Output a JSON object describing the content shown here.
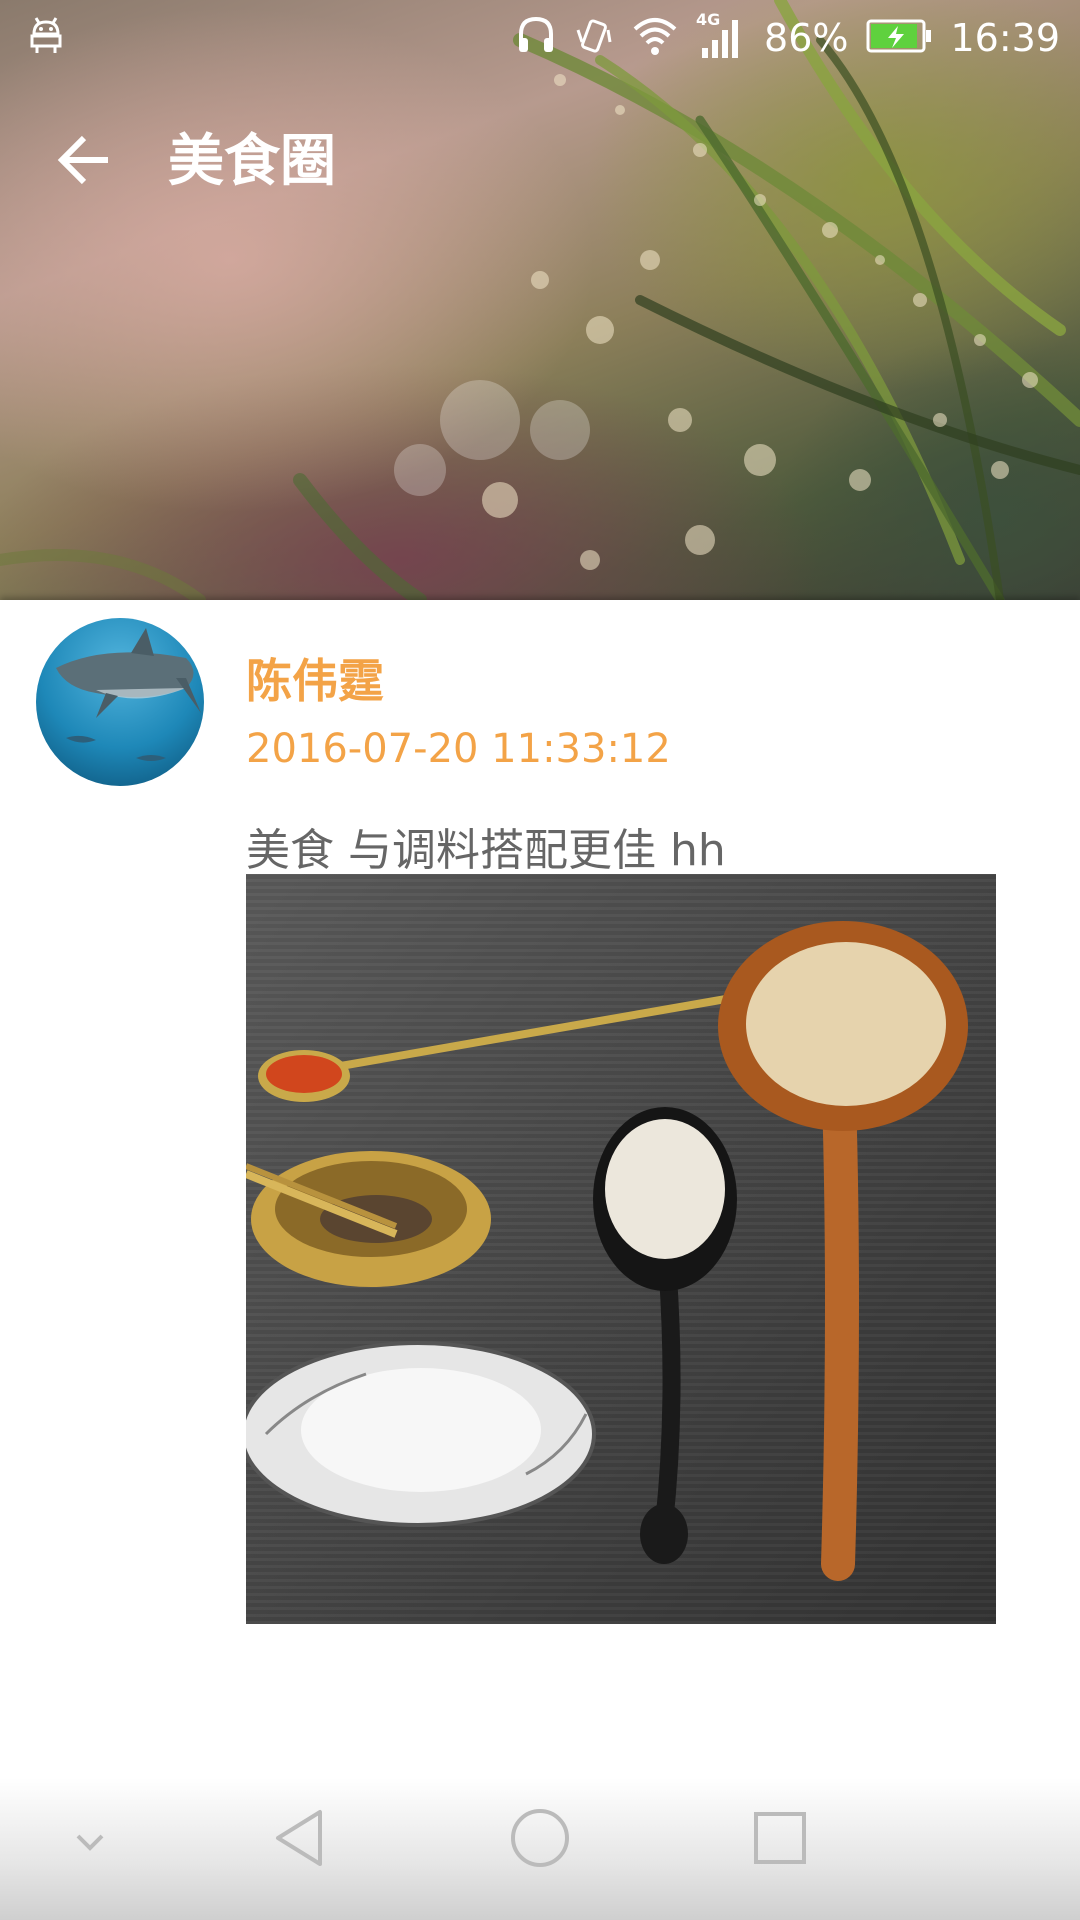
{
  "status_bar": {
    "battery_percent": "86%",
    "time": "16:39",
    "network_type": "4G",
    "icons": [
      "android-debug-icon",
      "headphone-icon",
      "vibrate-icon",
      "wifi-icon",
      "signal-icon",
      "battery-charging-icon"
    ]
  },
  "app_bar": {
    "title": "美食圈",
    "back_icon": "arrow-left-icon"
  },
  "post": {
    "username": "陈伟霆",
    "timestamp": "2016-07-20 11:33:12",
    "text": "美食 与调料搭配更佳 hh",
    "avatar_icon": "shark-avatar",
    "image_icon": "spices-photo"
  },
  "nav_bar": {
    "icons": [
      "chevron-down-icon",
      "back-triangle-icon",
      "home-circle-icon",
      "recents-square-icon"
    ]
  },
  "colors": {
    "accent": "#f3a347",
    "text_secondary": "#666666"
  }
}
